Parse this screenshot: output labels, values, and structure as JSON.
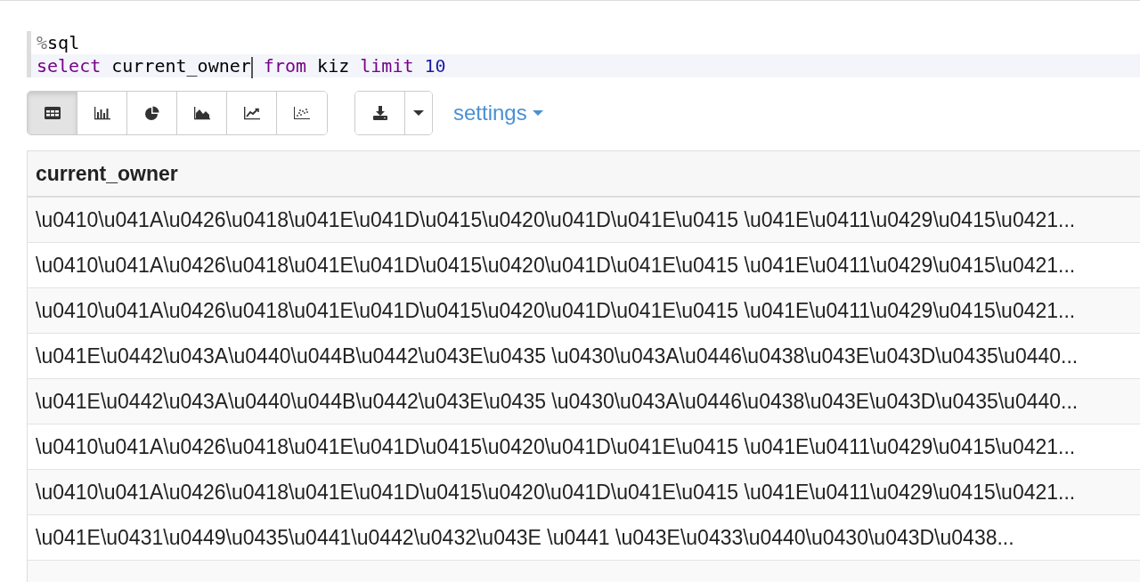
{
  "editor": {
    "lines": [
      {
        "active": false,
        "tokens": [
          {
            "kind": "meta",
            "text": "%"
          },
          {
            "kind": "plain",
            "text": "sql"
          }
        ]
      },
      {
        "active": true,
        "tokens": [
          {
            "kind": "keyword",
            "text": "select"
          },
          {
            "kind": "plain",
            "text": " current_owner",
            "cursor_after": true
          },
          {
            "kind": "keyword",
            "text": " from"
          },
          {
            "kind": "plain",
            "text": " kiz "
          },
          {
            "kind": "keyword",
            "text": "limit"
          },
          {
            "kind": "number",
            "text": " 10"
          }
        ]
      }
    ]
  },
  "toolbar": {
    "views": [
      {
        "kind": "table",
        "selected": true
      },
      {
        "kind": "bar",
        "selected": false
      },
      {
        "kind": "pie",
        "selected": false
      },
      {
        "kind": "area",
        "selected": false
      },
      {
        "kind": "line",
        "selected": false
      },
      {
        "kind": "scatter",
        "selected": false
      }
    ],
    "settings_label": "settings"
  },
  "table": {
    "columns": [
      "current_owner"
    ],
    "rows": [
      "\\u0410\\u041A\\u0426\\u0418\\u041E\\u041D\\u0415\\u0420\\u041D\\u041E\\u0415 \\u041E\\u0411\\u0429\\u0415\\u0421...",
      "\\u0410\\u041A\\u0426\\u0418\\u041E\\u041D\\u0415\\u0420\\u041D\\u041E\\u0415 \\u041E\\u0411\\u0429\\u0415\\u0421...",
      "\\u0410\\u041A\\u0426\\u0418\\u041E\\u041D\\u0415\\u0420\\u041D\\u041E\\u0415 \\u041E\\u0411\\u0429\\u0415\\u0421...",
      "\\u041E\\u0442\\u043A\\u0440\\u044B\\u0442\\u043E\\u0435 \\u0430\\u043A\\u0446\\u0438\\u043E\\u043D\\u0435\\u0440...",
      "\\u041E\\u0442\\u043A\\u0440\\u044B\\u0442\\u043E\\u0435 \\u0430\\u043A\\u0446\\u0438\\u043E\\u043D\\u0435\\u0440...",
      "\\u0410\\u041A\\u0426\\u0418\\u041E\\u041D\\u0415\\u0420\\u041D\\u041E\\u0415 \\u041E\\u0411\\u0429\\u0415\\u0421...",
      "\\u0410\\u041A\\u0426\\u0418\\u041E\\u041D\\u0415\\u0420\\u041D\\u041E\\u0415 \\u041E\\u0411\\u0429\\u0415\\u0421...",
      "\\u041E\\u0431\\u0449\\u0435\\u0441\\u0442\\u0432\\u043E \\u0441 \\u043E\\u0433\\u0440\\u0430\\u043D\\u0438..."
    ]
  }
}
